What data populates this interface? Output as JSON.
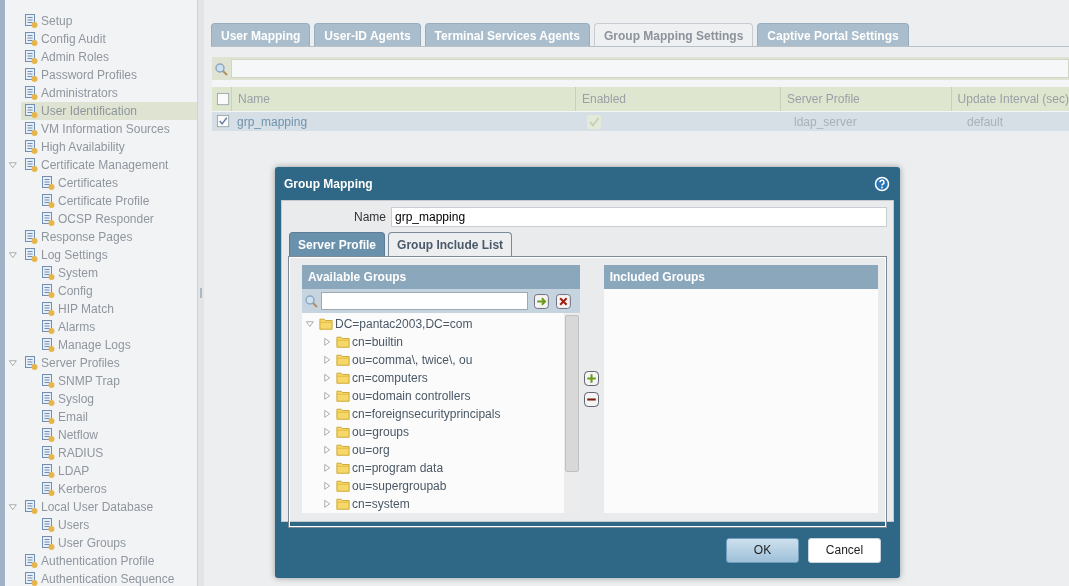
{
  "sidebar": {
    "items": [
      {
        "label": "Setup",
        "selected": false
      },
      {
        "label": "Config Audit",
        "selected": false
      },
      {
        "label": "Admin Roles",
        "selected": false
      },
      {
        "label": "Password Profiles",
        "selected": false
      },
      {
        "label": "Administrators",
        "selected": false
      },
      {
        "label": "User Identification",
        "selected": true
      },
      {
        "label": "VM Information Sources",
        "selected": false
      },
      {
        "label": "High Availability",
        "selected": false
      },
      {
        "label": "Certificate Management",
        "selected": false,
        "expanded": true,
        "children": [
          {
            "label": "Certificates",
            "selected": false
          },
          {
            "label": "Certificate Profile",
            "selected": false
          },
          {
            "label": "OCSP Responder",
            "selected": false
          }
        ]
      },
      {
        "label": "Response Pages",
        "selected": false
      },
      {
        "label": "Log Settings",
        "selected": false,
        "expanded": true,
        "children": [
          {
            "label": "System",
            "selected": false
          },
          {
            "label": "Config",
            "selected": false
          },
          {
            "label": "HIP Match",
            "selected": false
          },
          {
            "label": "Alarms",
            "selected": false
          },
          {
            "label": "Manage Logs",
            "selected": false
          }
        ]
      },
      {
        "label": "Server Profiles",
        "selected": false,
        "expanded": true,
        "children": [
          {
            "label": "SNMP Trap",
            "selected": false
          },
          {
            "label": "Syslog",
            "selected": false
          },
          {
            "label": "Email",
            "selected": false
          },
          {
            "label": "Netflow",
            "selected": false
          },
          {
            "label": "RADIUS",
            "selected": false
          },
          {
            "label": "LDAP",
            "selected": false
          },
          {
            "label": "Kerberos",
            "selected": false
          }
        ]
      },
      {
        "label": "Local User Database",
        "selected": false,
        "expanded": true,
        "children": [
          {
            "label": "Users",
            "selected": false
          },
          {
            "label": "User Groups",
            "selected": false
          }
        ]
      },
      {
        "label": "Authentication Profile",
        "selected": false
      },
      {
        "label": "Authentication Sequence",
        "selected": false
      }
    ]
  },
  "tabs": [
    {
      "label": "User Mapping",
      "selected": false
    },
    {
      "label": "User-ID Agents",
      "selected": false
    },
    {
      "label": "Terminal Services Agents",
      "selected": false
    },
    {
      "label": "Group Mapping Settings",
      "selected": true
    },
    {
      "label": "Captive Portal Settings",
      "selected": false
    }
  ],
  "table": {
    "select_all_checked": false,
    "columns": [
      "Name",
      "Enabled",
      "Server Profile",
      "Update Interval (sec)"
    ],
    "rows": [
      {
        "checked": true,
        "name": "grp_mapping",
        "enabled": true,
        "server_profile": "ldap_server",
        "update_interval": "default"
      }
    ]
  },
  "dialog": {
    "title": "Group Mapping",
    "name_label": "Name",
    "name_value": "grp_mapping",
    "tabs": [
      {
        "label": "Server Profile",
        "selected": false
      },
      {
        "label": "Group Include List",
        "selected": true
      }
    ],
    "available_groups": {
      "title": "Available Groups",
      "tree": [
        {
          "label": "DC=pantac2003,DC=com",
          "expanded": true,
          "children": [
            {
              "label": "cn=builtin",
              "expanded": false
            },
            {
              "label": "ou=comma\\, twice\\, ou",
              "expanded": false
            },
            {
              "label": "cn=computers",
              "expanded": false
            },
            {
              "label": "ou=domain controllers",
              "expanded": false
            },
            {
              "label": "cn=foreignsecurityprincipals",
              "expanded": false
            },
            {
              "label": "ou=groups",
              "expanded": false
            },
            {
              "label": "ou=org",
              "expanded": false
            },
            {
              "label": "cn=program data",
              "expanded": false
            },
            {
              "label": "ou=supergroupab",
              "expanded": false
            },
            {
              "label": "cn=system",
              "expanded": false
            }
          ]
        }
      ]
    },
    "included_groups": {
      "title": "Included Groups"
    },
    "buttons": [
      {
        "label": "OK",
        "default": true
      },
      {
        "label": "Cancel",
        "default": false
      }
    ]
  }
}
